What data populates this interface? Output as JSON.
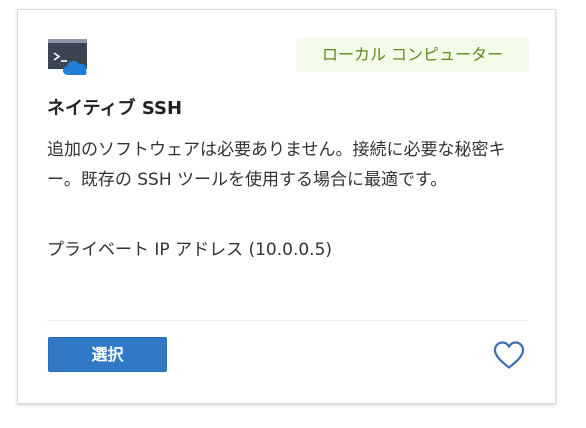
{
  "card": {
    "icon": "terminal-cloud-icon",
    "badge": "ローカル コンピューター",
    "title": "ネイティブ SSH",
    "description": "追加のソフトウェアは必要ありません。接続に必要な秘密キー。既存の SSH ツールを使用する場合に最適です。",
    "ip_label": "プライベート IP アドレス (10.0.0.5)",
    "select_label": "選択",
    "favorite_icon": "heart-outline-icon"
  },
  "colors": {
    "badge_background": "#f4fae9",
    "badge_text": "#5d8b1f",
    "primary_button": "#3179c7",
    "heart_stroke": "#3a6fb0"
  }
}
